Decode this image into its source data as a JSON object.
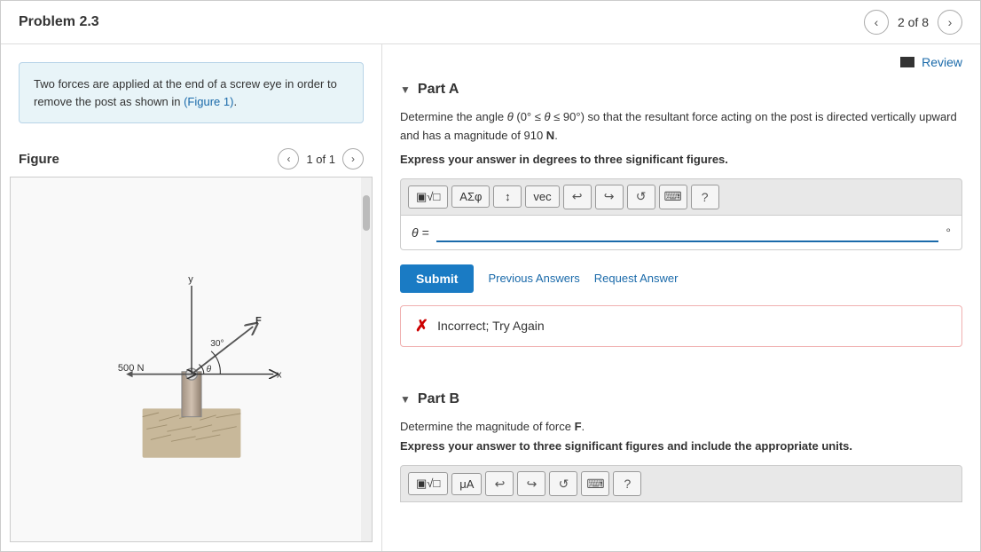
{
  "header": {
    "title": "Problem 2.3",
    "nav_prev_label": "‹",
    "nav_next_label": "›",
    "nav_current": "2 of 8"
  },
  "left_panel": {
    "problem_desc": "Two forces are applied at the end of a screw eye in order to remove the post as shown in ",
    "figure_link": "(Figure 1)",
    "figure_link_text": "Figure 1",
    "figure_period": ").",
    "figure_title": "Figure",
    "figure_count": "1 of 1"
  },
  "right_panel": {
    "review_label": "Review",
    "part_a": {
      "label": "Part A",
      "question_text": "Determine the angle θ (0° ≤ θ ≤ 90°) so that the resultant force acting on the post is directed vertically upward and has a magnitude of 910 N.",
      "express_text": "Express your answer in degrees to three significant figures.",
      "input_label": "θ =",
      "degree_symbol": "°",
      "toolbar": {
        "btn1": "▣√□",
        "btn2": "ΑΣφ",
        "btn3": "↕↓",
        "btn4": "vec",
        "btn5": "↩",
        "btn6": "↪",
        "btn7": "↺",
        "btn8": "⌨",
        "btn9": "?"
      },
      "submit_label": "Submit",
      "prev_answers_label": "Previous Answers",
      "request_answer_label": "Request Answer",
      "incorrect_label": "Incorrect; Try Again"
    },
    "part_b": {
      "label": "Part B",
      "question_text": "Determine the magnitude of force F.",
      "express_text": "Express your answer to three significant figures and include the appropriate units.",
      "toolbar": {
        "btn1": "▣√□",
        "btn2": "μA",
        "btn3": "↩",
        "btn4": "↪",
        "btn5": "↺",
        "btn6": "⌨",
        "btn7": "?"
      }
    }
  },
  "figure": {
    "force_500": "500 N",
    "force_f": "F",
    "angle_30": "30°",
    "angle_theta": "θ",
    "axis_x": "x",
    "axis_y": "y"
  }
}
